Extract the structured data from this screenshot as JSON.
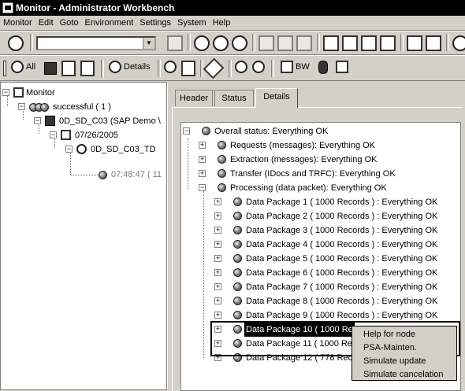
{
  "window": {
    "title": "Monitor - Administrator Workbench"
  },
  "menu": [
    "Monitor",
    "Edit",
    "Goto",
    "Environment",
    "Settings",
    "System",
    "Help"
  ],
  "toolbar2": {
    "all_label": "All",
    "details_label": "Details",
    "bw_label": "BW"
  },
  "left_tree": {
    "root": "Monitor",
    "status": "successful ( 1 )",
    "object": "0D_SD_C03 (SAP Demo \\",
    "date": "07/26/2005",
    "request": "0D_SD_C03_TD",
    "time": "07:48:47 ( 11"
  },
  "tabs": [
    "Header",
    "Status",
    "Details"
  ],
  "active_tab": "Details",
  "detail_tree": {
    "overall": "Overall status: Everything OK",
    "requests": "Requests (messages): Everything OK",
    "extraction": "Extraction (messages): Everything OK",
    "transfer": "Transfer (IDocs and TRFC): Everything OK",
    "processing": "Processing (data packet): Everything OK",
    "packages": [
      "Data Package 1 ( 1000 Records ) : Everything OK",
      "Data Package 2 ( 1000 Records ) : Everything OK",
      "Data Package 3 ( 1000 Records ) : Everything OK",
      "Data Package 4 ( 1000 Records ) : Everything OK",
      "Data Package 5 ( 1000 Records ) : Everything OK",
      "Data Package 6 ( 1000 Records ) : Everything OK",
      "Data Package 7 ( 1000 Records ) : Everything OK",
      "Data Package 8 ( 1000 Records ) : Everything OK",
      "Data Package 9 ( 1000 Records ) : Everything OK",
      "Data Package 10 ( 1000 Re",
      "Data Package 11 ( 1000 Re",
      "Data Package 12 ( 778 Rec"
    ]
  },
  "context_menu": [
    "Help for node",
    "PSA-Mainten.",
    "Simulate update",
    "Simulate cancelation"
  ]
}
